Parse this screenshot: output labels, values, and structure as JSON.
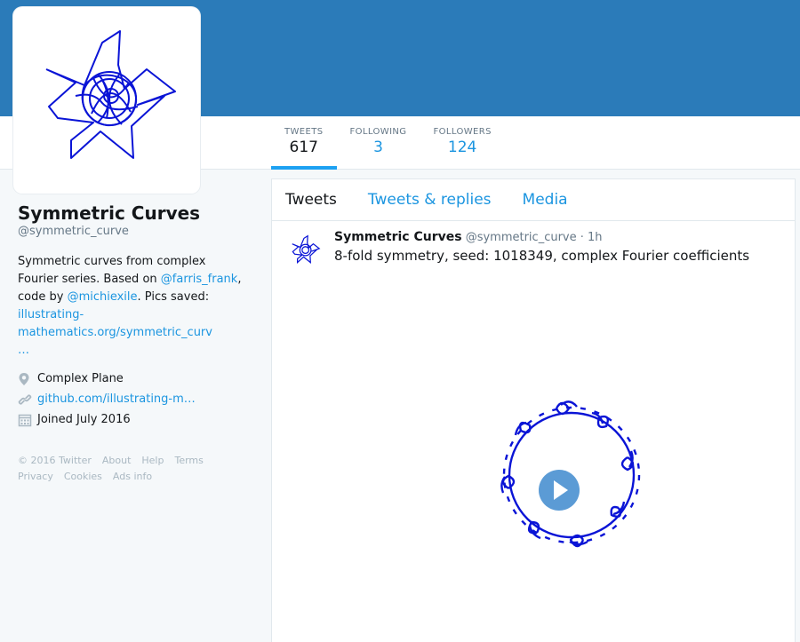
{
  "profile": {
    "name": "Symmetric Curves",
    "handle": "@symmetric_curve",
    "bio_part1": "Symmetric curves from complex Fourier series. Based on ",
    "bio_link1": "@farris_frank",
    "bio_part2": ", code by ",
    "bio_link2": "@michiexile",
    "bio_part3": ". Pics saved: ",
    "bio_link3": "illustrating-mathematics.org/symmetric_curv",
    "bio_ellipsis": "…",
    "location": "Complex Plane",
    "website": "github.com/illustrating-m…",
    "joined": "Joined July 2016"
  },
  "stats": [
    {
      "label": "TWEETS",
      "value": "617"
    },
    {
      "label": "FOLLOWING",
      "value": "3"
    },
    {
      "label": "FOLLOWERS",
      "value": "124"
    }
  ],
  "timeline": {
    "tabs": [
      "Tweets",
      "Tweets & replies",
      "Media"
    ]
  },
  "tweet": {
    "name": "Symmetric Curves",
    "handle": "@symmetric_curve",
    "sep": " · ",
    "time": "1h",
    "text": "8-fold symmetry, seed: 1018349, complex Fourier coefficients"
  },
  "footer": {
    "copyright": "© 2016 Twitter",
    "about": "About",
    "help": "Help",
    "terms": "Terms",
    "privacy": "Privacy",
    "cookies": "Cookies",
    "ads": "Ads info"
  },
  "colors": {
    "banner": "#2b7bb9",
    "link": "#1b95e0",
    "curve": "#0a14d6"
  },
  "icons": [
    "location-icon",
    "link-icon",
    "calendar-icon",
    "play-icon"
  ]
}
